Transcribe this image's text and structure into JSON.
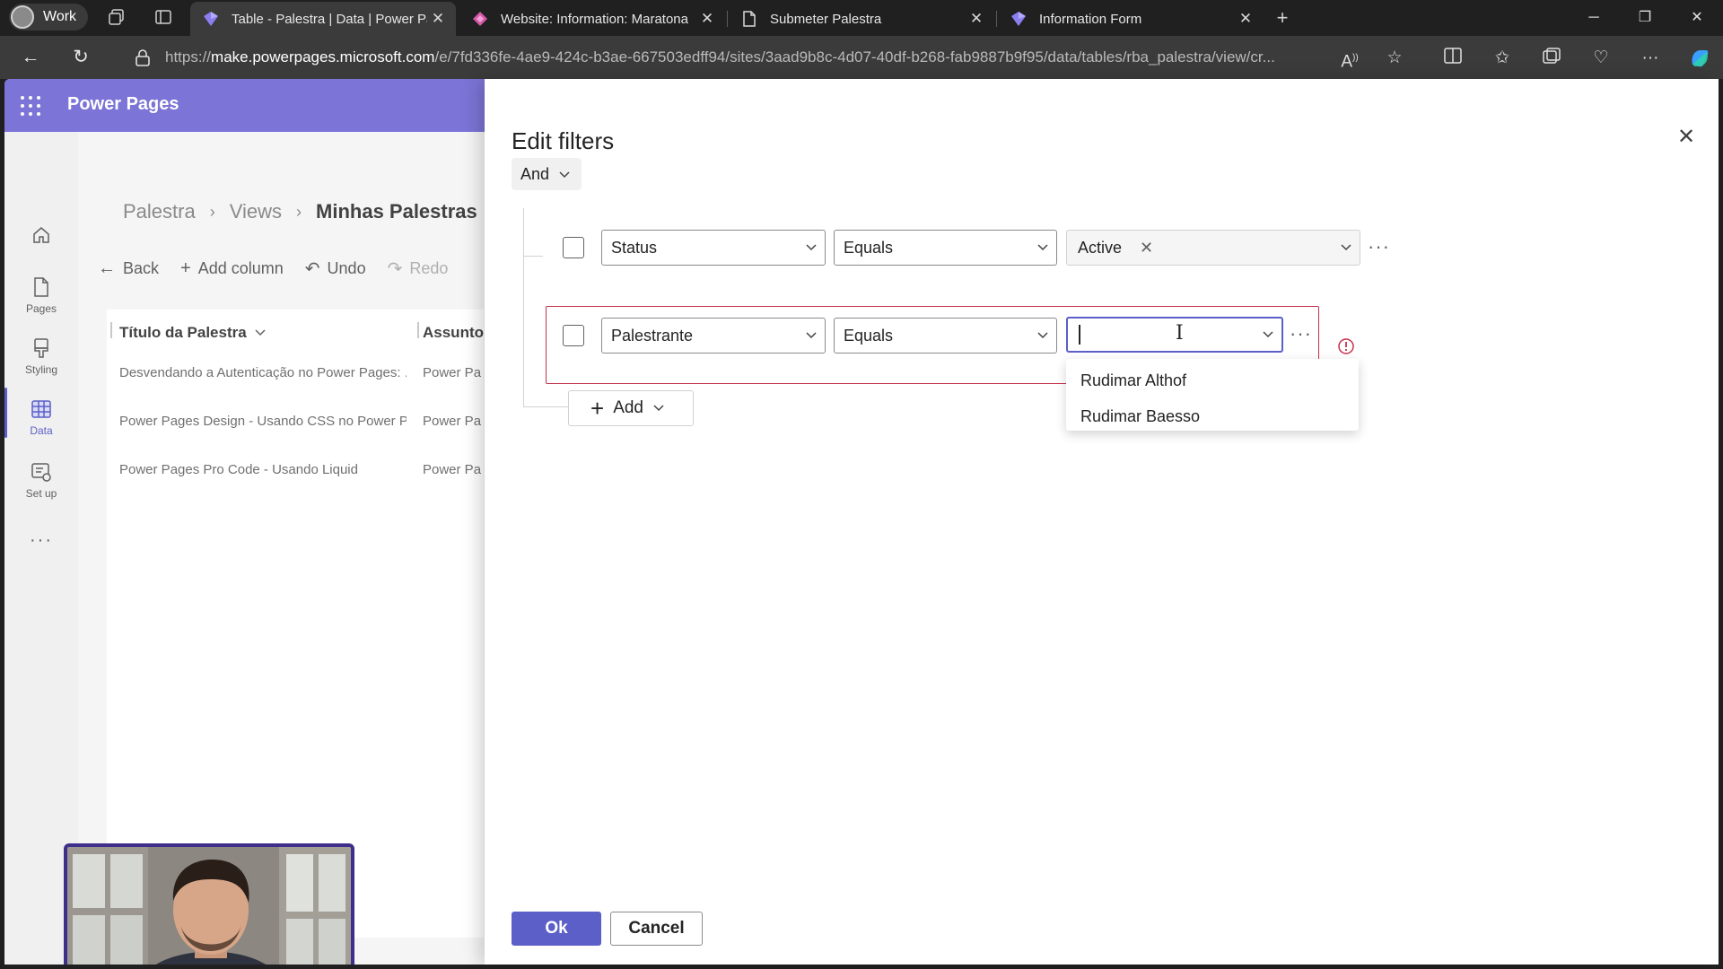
{
  "browser": {
    "profile_label": "Work",
    "tabs": [
      {
        "title": "Table - Palestra | Data | Power Pa"
      },
      {
        "title": "Website: Information: Maratona"
      },
      {
        "title": "Submeter Palestra"
      },
      {
        "title": "Information Form"
      }
    ],
    "url_prefix": "https://",
    "url_host": "make.powerpages.microsoft.com",
    "url_path": "/e/7fd336fe-4ae9-424c-b3ae-667503edff94/sites/3aad9b8c-4d07-40df-b268-fab9887b9f95/data/tables/rba_palestra/view/cr..."
  },
  "app": {
    "title": "Power Pages",
    "rail": [
      {
        "label": "Pages"
      },
      {
        "label": "Styling"
      },
      {
        "label": "Data"
      },
      {
        "label": "Set up"
      }
    ],
    "rail_more": "···"
  },
  "workspace": {
    "breadcrumb": [
      "Palestra",
      "Views",
      "Minhas Palestras"
    ],
    "commands": {
      "back": "Back",
      "add_column": "Add column",
      "undo": "Undo",
      "redo": "Redo"
    },
    "grid": {
      "columns": [
        "Título da Palestra",
        "Assunto"
      ],
      "rows": [
        {
          "title": "Desvendando a Autenticação no Power Pages: ...",
          "subject": "Power Pa"
        },
        {
          "title": "Power Pages Design - Usando CSS no Power Pa...",
          "subject": "Power Pa"
        },
        {
          "title": "Power Pages Pro Code - Usando Liquid",
          "subject": "Power Pa"
        }
      ]
    }
  },
  "panel": {
    "title": "Edit filters",
    "group_operator": "And",
    "rows": [
      {
        "field": "Status",
        "operator": "Equals",
        "value_chip": "Active"
      },
      {
        "field": "Palestrante",
        "operator": "Equals",
        "value_chip": ""
      }
    ],
    "more_label": "···",
    "dropdown_options": [
      "Rudimar Althof",
      "Rudimar Baesso"
    ],
    "add_label": "Add",
    "ok_label": "Ok",
    "cancel_label": "Cancel"
  },
  "colors": {
    "accent": "#5b5fc7",
    "header": "#7c74d6",
    "error": "#c4314b"
  }
}
